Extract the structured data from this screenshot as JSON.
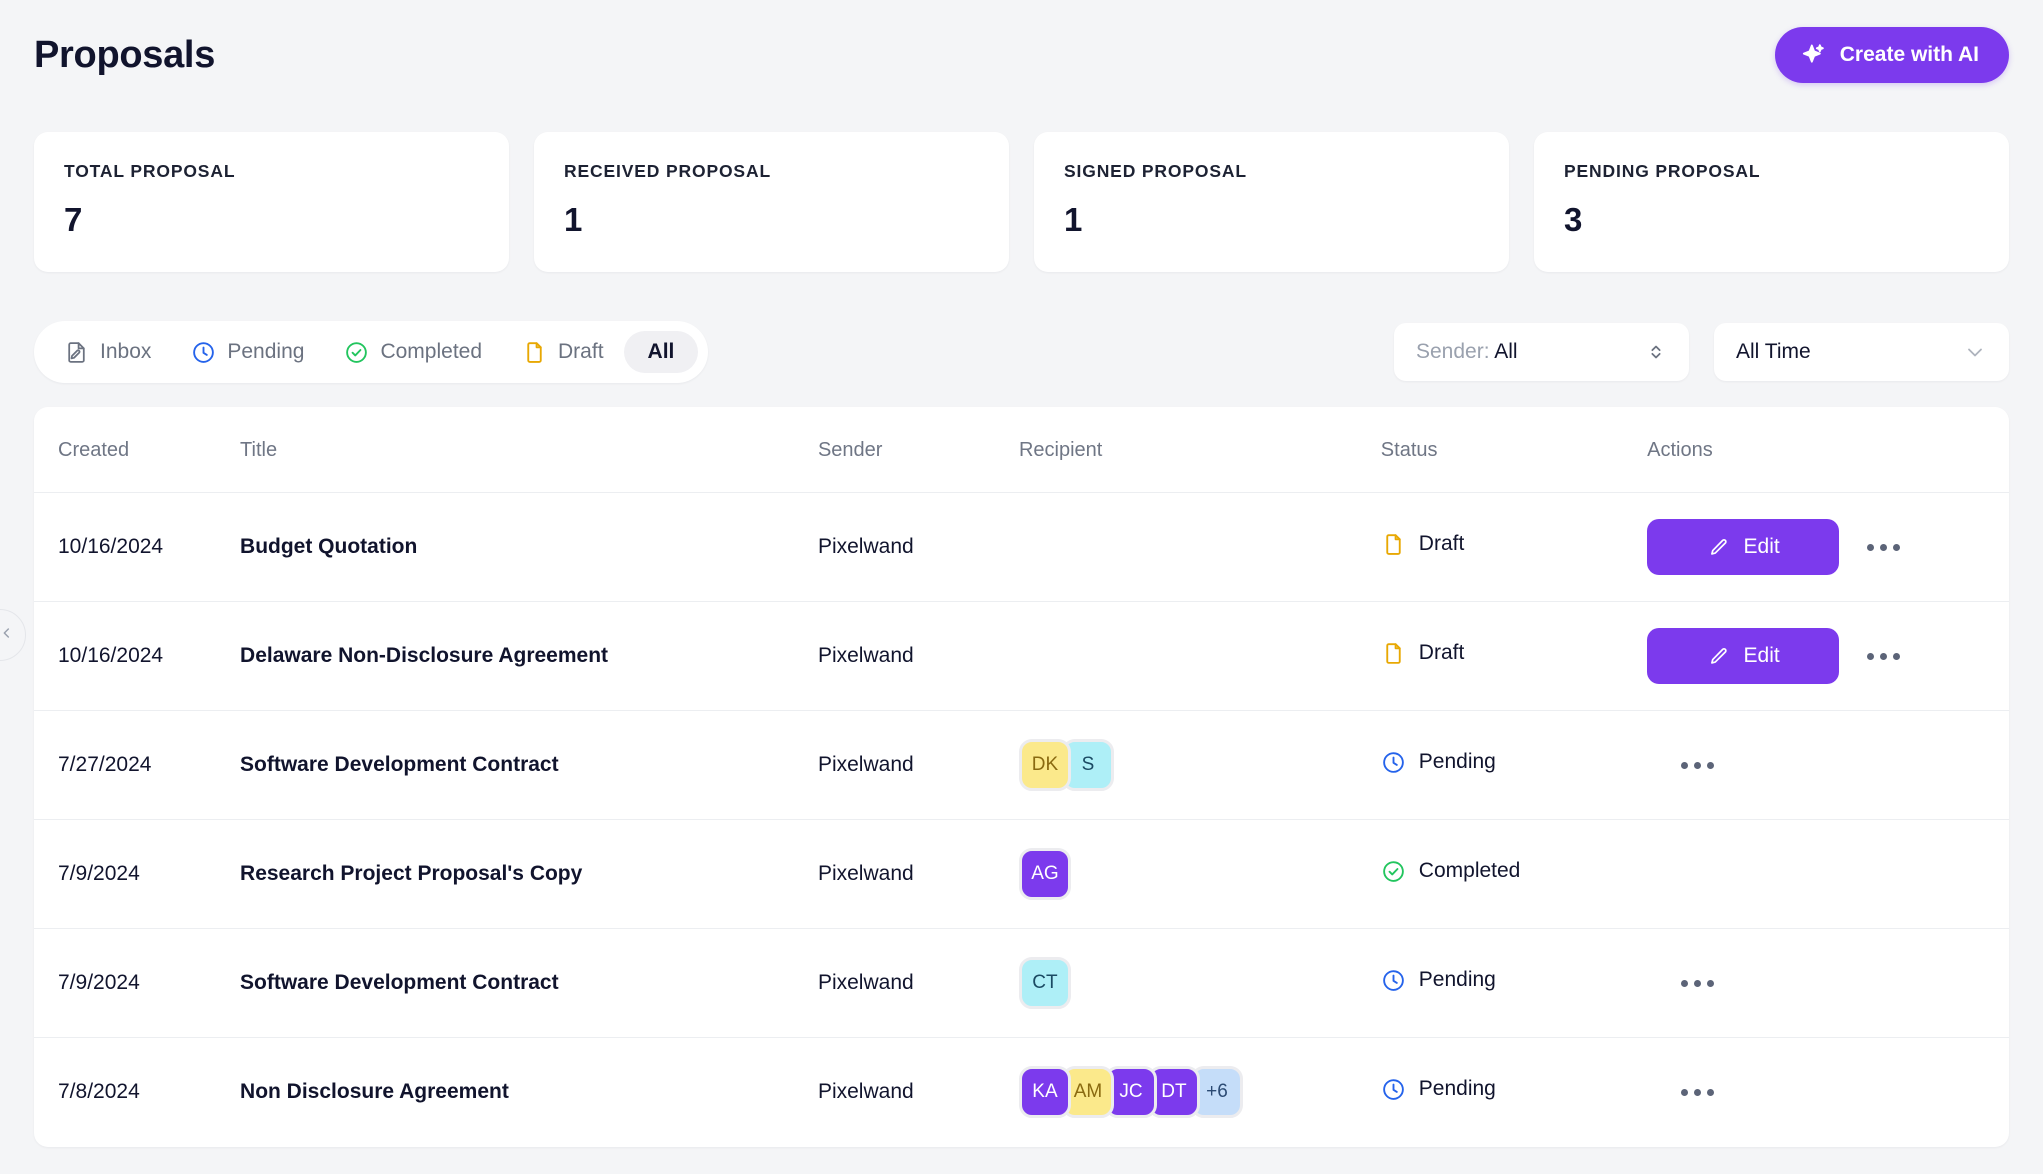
{
  "header": {
    "title": "Proposals",
    "create_button": {
      "label": "Create with AI",
      "icon": "sparkle-icon",
      "color": "#7c3aed"
    }
  },
  "stats": [
    {
      "label": "TOTAL PROPOSAL",
      "value": "7"
    },
    {
      "label": "RECEIVED PROPOSAL",
      "value": "1"
    },
    {
      "label": "SIGNED PROPOSAL",
      "value": "1"
    },
    {
      "label": "PENDING PROPOSAL",
      "value": "3"
    }
  ],
  "tabs": [
    {
      "label": "Inbox",
      "icon": "document-edit-icon",
      "color": "#6b7280",
      "active": false
    },
    {
      "label": "Pending",
      "icon": "clock-icon",
      "color": "#2563eb",
      "active": false
    },
    {
      "label": "Completed",
      "icon": "check-circle-icon",
      "color": "#22c55e",
      "active": false
    },
    {
      "label": "Draft",
      "icon": "document-icon",
      "color": "#e8a803",
      "active": false
    },
    {
      "label": "All",
      "icon": "none",
      "color": "#11142d",
      "active": true
    }
  ],
  "filters": {
    "sender": {
      "prefix": "Sender:",
      "value": "All",
      "icon": "chevron-up-down-icon"
    },
    "time": {
      "value": "All Time",
      "icon": "chevron-down-icon"
    }
  },
  "table": {
    "columns": [
      "Created",
      "Title",
      "Sender",
      "Recipient",
      "Status",
      "Actions"
    ],
    "rows": [
      {
        "created": "10/16/2024",
        "title": "Budget Quotation",
        "sender": "Pixelwand",
        "recipients": [],
        "status": {
          "label": "Draft",
          "icon": "document-icon",
          "color": "#e8a803"
        },
        "actions": {
          "edit_label": "Edit",
          "has_edit": true,
          "more_label": "More options"
        }
      },
      {
        "created": "10/16/2024",
        "title": "Delaware Non-Disclosure Agreement",
        "sender": "Pixelwand",
        "recipients": [],
        "status": {
          "label": "Draft",
          "icon": "document-icon",
          "color": "#e8a803"
        },
        "actions": {
          "edit_label": "Edit",
          "has_edit": true,
          "more_label": "More options"
        }
      },
      {
        "created": "7/27/2024",
        "title": "Software Development Contract",
        "sender": "Pixelwand",
        "recipients": [
          {
            "initials": "DK",
            "bg": "#fbe98b",
            "fg": "#8a6a10"
          },
          {
            "initials": "S",
            "bg": "#aeeff7",
            "fg": "#1b4a63"
          }
        ],
        "status": {
          "label": "Pending",
          "icon": "clock-icon",
          "color": "#2563eb"
        },
        "actions": {
          "edit_label": "Edit",
          "has_edit": false,
          "more_label": "More options"
        }
      },
      {
        "created": "7/9/2024",
        "title": "Research Project Proposal's Copy",
        "sender": "Pixelwand",
        "recipients": [
          {
            "initials": "AG",
            "bg": "#7c3aed",
            "fg": "#ffffff"
          }
        ],
        "status": {
          "label": "Completed",
          "icon": "check-circle-icon",
          "color": "#22c55e"
        },
        "actions": {
          "edit_label": "Edit",
          "has_edit": false,
          "more_label": "More options",
          "show_more": false
        }
      },
      {
        "created": "7/9/2024",
        "title": "Software Development Contract",
        "sender": "Pixelwand",
        "recipients": [
          {
            "initials": "CT",
            "bg": "#aeeff7",
            "fg": "#1b4a63"
          }
        ],
        "status": {
          "label": "Pending",
          "icon": "clock-icon",
          "color": "#2563eb"
        },
        "actions": {
          "edit_label": "Edit",
          "has_edit": false,
          "more_label": "More options"
        }
      },
      {
        "created": "7/8/2024",
        "title": "Non Disclosure Agreement",
        "sender": "Pixelwand",
        "recipients": [
          {
            "initials": "KA",
            "bg": "#7c3aed",
            "fg": "#ffffff"
          },
          {
            "initials": "AM",
            "bg": "#fbe98b",
            "fg": "#8a6a10"
          },
          {
            "initials": "JC",
            "bg": "#7c3aed",
            "fg": "#ffffff"
          },
          {
            "initials": "DT",
            "bg": "#7c3aed",
            "fg": "#ffffff"
          },
          {
            "initials": "+6",
            "bg": "#c5ddf9",
            "fg": "#2b4a73"
          }
        ],
        "status": {
          "label": "Pending",
          "icon": "clock-icon",
          "color": "#2563eb"
        },
        "actions": {
          "edit_label": "Edit",
          "has_edit": false,
          "more_label": "More options"
        }
      }
    ]
  },
  "sidebar_toggle": {
    "icon": "chevron-left-icon"
  }
}
